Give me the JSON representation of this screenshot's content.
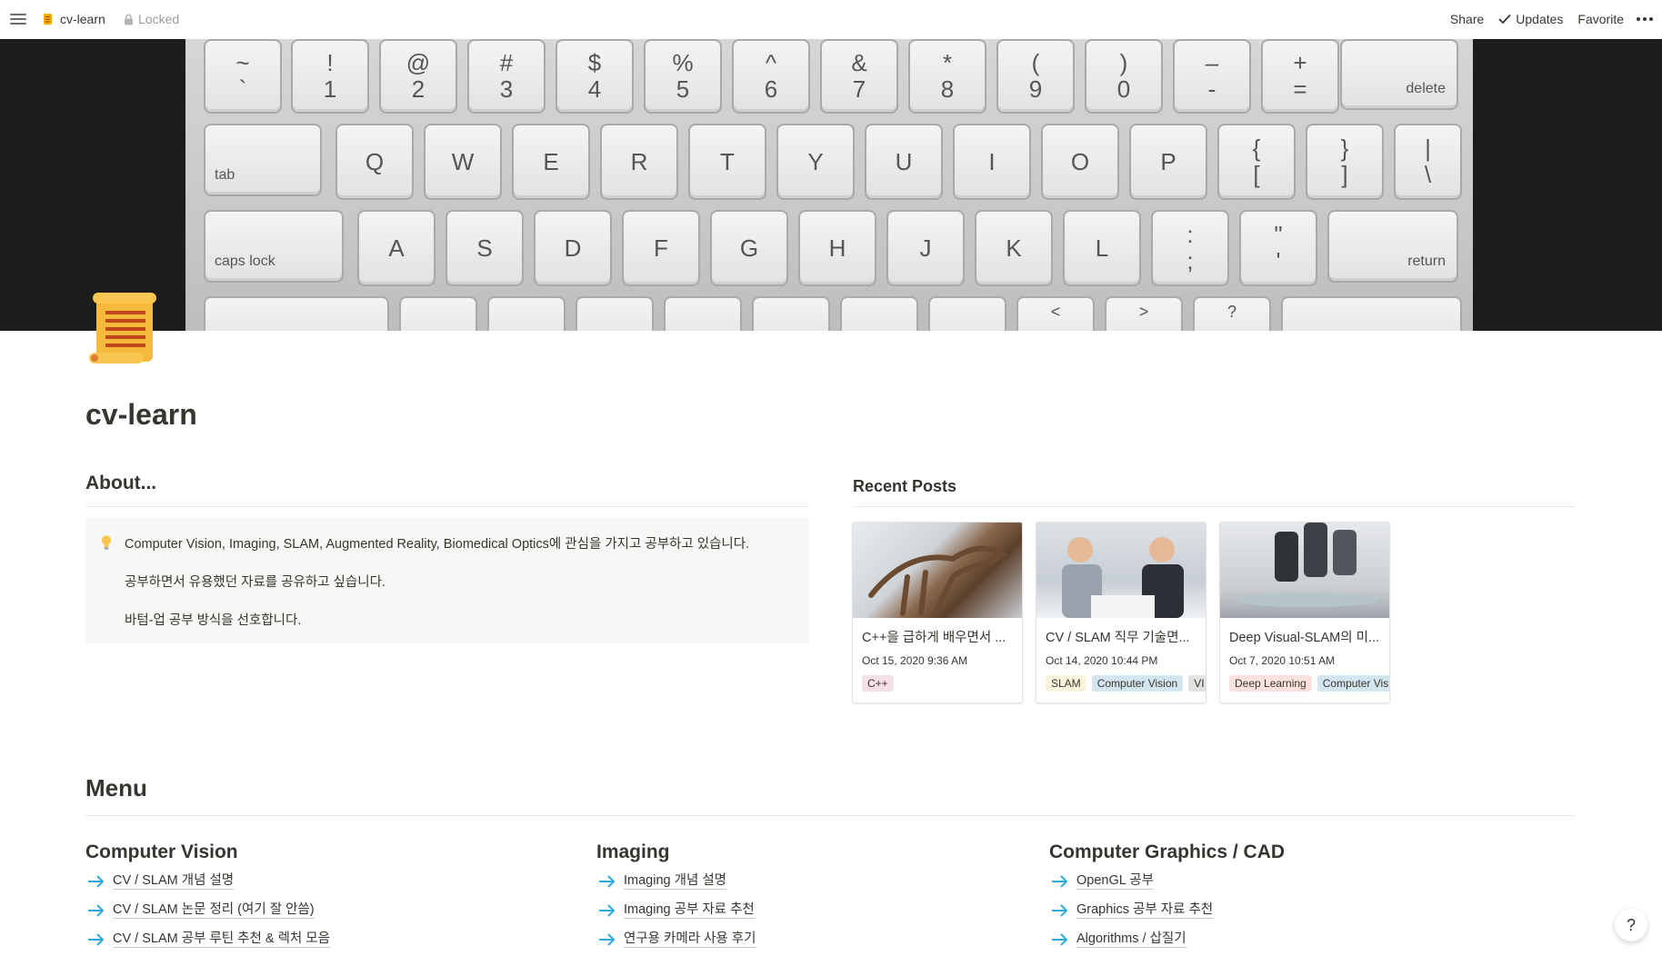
{
  "topbar": {
    "page_name": "cv-learn",
    "locked_label": "Locked",
    "share_label": "Share",
    "updates_label": "Updates",
    "favorite_label": "Favorite"
  },
  "page": {
    "title": "cv-learn"
  },
  "about": {
    "heading": "About...",
    "lines": [
      "Computer Vision, Imaging, SLAM, Augmented Reality, Biomedical Optics에 관심을 가지고 공부하고 있습니다.",
      "공부하면서 유용했던 자료를 공유하고 싶습니다.",
      "바텀-업 공부 방식을 선호합니다."
    ]
  },
  "recent": {
    "heading": "Recent Posts",
    "cards": [
      {
        "title": "C++을 급하게 배우면서 ...",
        "date": "Oct 15, 2020 9:36 AM",
        "tags": [
          "C++"
        ]
      },
      {
        "title": "CV / SLAM 직무 기술면...",
        "date": "Oct 14, 2020 10:44 PM",
        "tags": [
          "SLAM",
          "Computer Vision",
          "VI"
        ]
      },
      {
        "title": "Deep Visual-SLAM의 미...",
        "date": "Oct 7, 2020 10:51 AM",
        "tags": [
          "Deep Learning",
          "Computer Visi"
        ]
      }
    ]
  },
  "menu": {
    "heading": "Menu",
    "columns": [
      {
        "heading": "Computer Vision",
        "links": [
          "CV / SLAM 개념 설명",
          "CV / SLAM 논문 정리 (여기 잘 안씀)",
          "CV / SLAM 공부 루틴 추천 & 렉처 모음"
        ]
      },
      {
        "heading": "Imaging",
        "links": [
          "Imaging 개념 설명",
          "Imaging 공부 자료 추천",
          "연구용 카메라 사용 후기"
        ]
      },
      {
        "heading": "Computer Graphics / CAD",
        "links": [
          "OpenGL 공부",
          "Graphics 공부 자료 추천",
          "Algorithms / 삽질기"
        ]
      }
    ]
  },
  "help": {
    "label": "?"
  },
  "colors": {
    "text": "#37352f",
    "tag_cpp": "#f5e0e9",
    "tag_slam": "#fbf3db",
    "tag_cv": "#d3e5ef",
    "tag_gray": "#e3e2e0",
    "tag_dl": "#ffe2dd",
    "link_arrow": "#2eaadc"
  },
  "icons": [
    "menu-icon",
    "scroll-icon",
    "lock-icon",
    "check-icon",
    "more-icon",
    "lightbulb-icon",
    "arrow-right-icon"
  ]
}
